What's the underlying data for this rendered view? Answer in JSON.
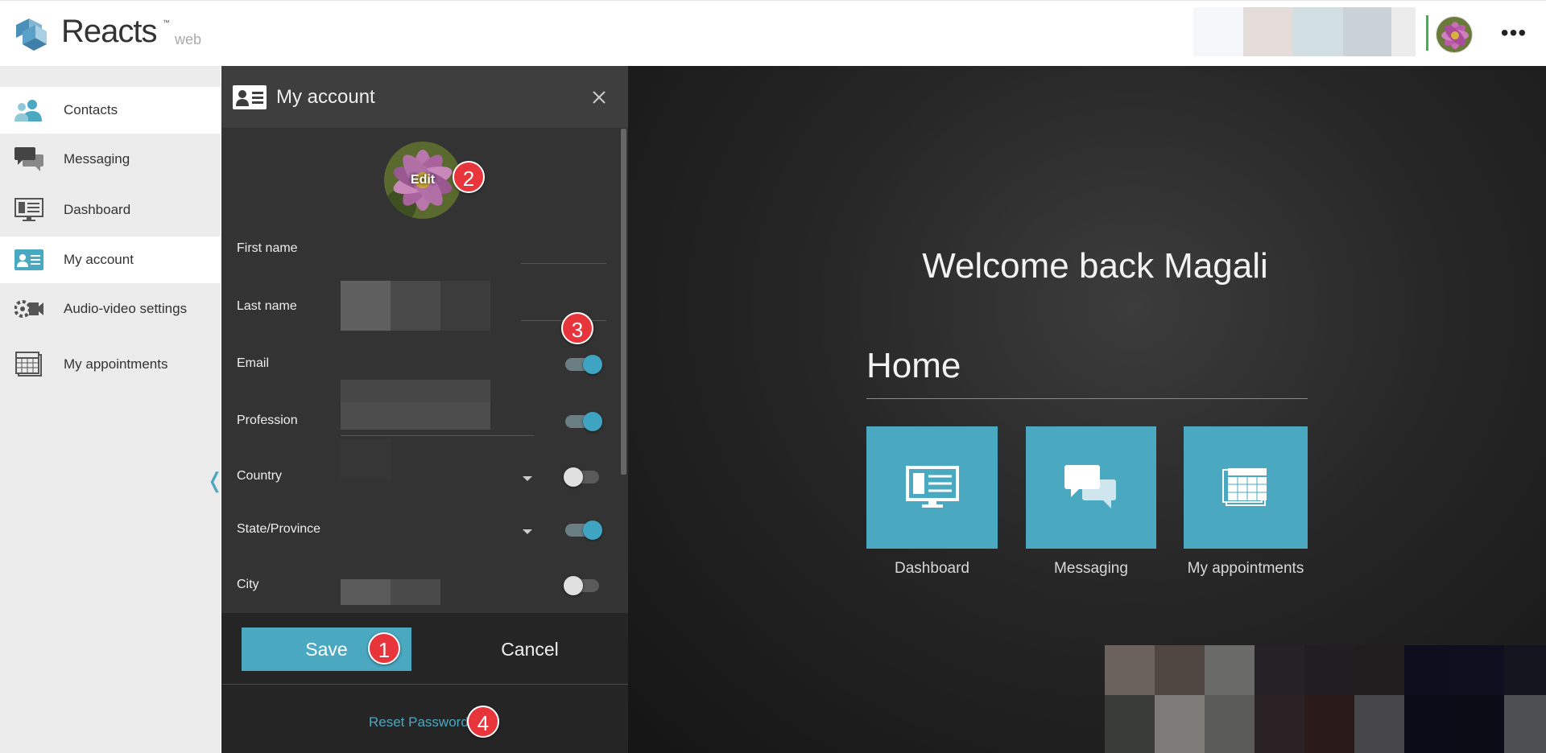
{
  "app": {
    "name": "Reacts",
    "trademark": "™",
    "subtitle": "web"
  },
  "header": {
    "more_label": "•••"
  },
  "sidebar": {
    "items": [
      {
        "label": "Contacts",
        "icon": "contacts-icon",
        "active": true
      },
      {
        "label": "Messaging",
        "icon": "messaging-icon",
        "active": false
      },
      {
        "label": "Dashboard",
        "icon": "dashboard-icon",
        "active": false
      },
      {
        "label": "My account",
        "icon": "account-card-icon",
        "active": true
      },
      {
        "label": "Audio-video settings",
        "icon": "camera-settings-icon",
        "active": false
      },
      {
        "label": "My appointments",
        "icon": "calendar-icon",
        "active": false
      }
    ],
    "collapse_glyph": "❬"
  },
  "panel": {
    "title": "My account",
    "avatar_edit_label": "Edit",
    "fields": [
      {
        "label": "First name"
      },
      {
        "label": "Last name"
      },
      {
        "label": "Email",
        "toggle": true
      },
      {
        "label": "Profession",
        "toggle": true
      },
      {
        "label": "Country",
        "toggle": false
      },
      {
        "label": "State/Province",
        "toggle": true
      },
      {
        "label": "City",
        "toggle": false
      }
    ],
    "save_label": "Save",
    "cancel_label": "Cancel",
    "reset_password_label": "Reset Password"
  },
  "badges": {
    "save": "1",
    "edit": "2",
    "toggles": "3",
    "reset": "4"
  },
  "main": {
    "welcome": "Welcome back Magali",
    "home_title": "Home",
    "tiles": [
      {
        "label": "Dashboard",
        "icon": "dashboard-icon"
      },
      {
        "label": "Messaging",
        "icon": "messaging-icon"
      },
      {
        "label": "My appointments",
        "icon": "calendar-icon"
      }
    ]
  },
  "colors": {
    "accent": "#4aa8c0",
    "badge_red": "#e8343b",
    "status_green": "#3ab54a",
    "panel_bg": "#333333",
    "sidebar_bg": "#ececec"
  }
}
